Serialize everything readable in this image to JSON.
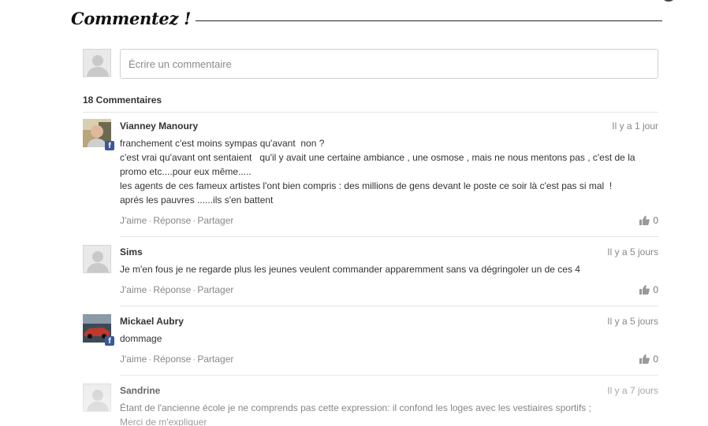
{
  "section": {
    "title": "Commentez !"
  },
  "compose": {
    "placeholder": "Écrire un commentaire"
  },
  "comment_count": "18 Commentaires",
  "actions": {
    "like": "J'aime",
    "reply": "Réponse",
    "share": "Partager",
    "separator": "·"
  },
  "icons": {
    "like": "thumbs-up-icon",
    "facebook": "facebook-badge-icon",
    "avatar": "default-avatar-icon"
  },
  "colors": {
    "facebook": "#3b5998",
    "muted": "#888888",
    "text": "#333333"
  },
  "comments": [
    {
      "author": "Vianney Manoury",
      "time": "Il y a 1 jour",
      "lines": [
        "franchement c'est moins sympas qu'avant  non ?",
        "c'est vrai qu'avant ont sentaient   qu'il y avait une certaine ambiance , une osmose , mais ne nous mentons pas , c'est de la promo etc....pour eux même.....",
        "les agents de ces fameux artistes l'ont bien compris : des millions de gens devant le poste ce soir là c'est pas si mal  !",
        "aprés les pauvres ......ils s'en battent"
      ],
      "likes": "0"
    },
    {
      "author": "Sims",
      "time": "Il y a 5 jours",
      "lines": [
        "Je m'en fous je ne regarde plus les jeunes veulent commander apparemment sans va dégringoler un de ces 4"
      ],
      "likes": "0"
    },
    {
      "author": "Mickael Aubry",
      "time": "Il y a 5 jours",
      "lines": [
        "dommage"
      ],
      "likes": "0"
    },
    {
      "author": "Sandrine",
      "time": "Il y a 7 jours",
      "lines": [
        "Étant de l'ancienne école je ne comprends pas cette expression: il confond les loges avec les vestiaires sportifs ;",
        "Merci de m'expliquer"
      ]
    }
  ]
}
